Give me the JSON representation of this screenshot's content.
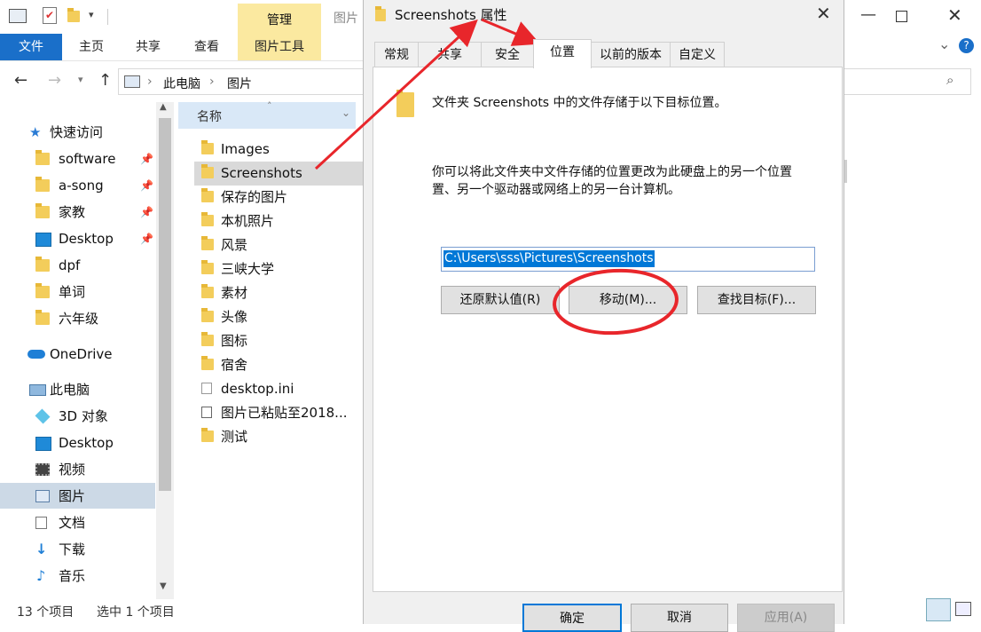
{
  "explorer": {
    "ribbon_tabs": [
      "文件",
      "主页",
      "共享",
      "查看"
    ],
    "manage_label": "管理",
    "picture_tools": "图片工具",
    "behind_title": "图片",
    "breadcrumb": [
      "此电脑",
      "图片"
    ],
    "column_header": "名称",
    "sidebar": {
      "quick_access": "快速访问",
      "pinned": [
        "software",
        "a-song",
        "家教",
        "Desktop"
      ],
      "recent": [
        "dpf",
        "单词",
        "六年级"
      ],
      "onedrive": "OneDrive",
      "this_pc": "此电脑",
      "pc_items": [
        "3D 对象",
        "Desktop",
        "视频",
        "图片",
        "文档",
        "下载",
        "音乐"
      ]
    },
    "files": [
      "Images",
      "Screenshots",
      "保存的图片",
      "本机照片",
      "风景",
      "三峡大学",
      "素材",
      "头像",
      "图标",
      "宿舍",
      "desktop.ini",
      "图片已粘贴至2018...",
      "测试"
    ],
    "status_count": "13 个项目",
    "status_selected": "选中 1 个项目"
  },
  "dialog": {
    "title": "Screenshots 属性",
    "tabs": [
      "常规",
      "共享",
      "安全",
      "位置",
      "以前的版本",
      "自定义"
    ],
    "description": "文件夹 Screenshots 中的文件存储于以下目标位置。",
    "info_line1": "你可以将此文件夹中文件存储的位置更改为此硬盘上的另一个位置、",
    "info_line2": "另一个驱动器或网络上的另一台计算机。",
    "info_line1_display": "你可以将此文件夹中文件存储的位置更改为此硬盘上的另一个位置",
    "info_line2_display": "置、另一个驱动器或网络上的另一台计算机。",
    "path_value": "C:\\Users\\sss\\Pictures\\Screenshots",
    "btn_restore": "还原默认值(R)",
    "btn_move": "移动(M)...",
    "btn_find": "查找目标(F)...",
    "btn_ok": "确定",
    "btn_cancel": "取消",
    "btn_apply": "应用(A)"
  },
  "colors": {
    "accent": "#1a6fc9",
    "annotation": "#e8262b",
    "selection": "#0078d7"
  }
}
